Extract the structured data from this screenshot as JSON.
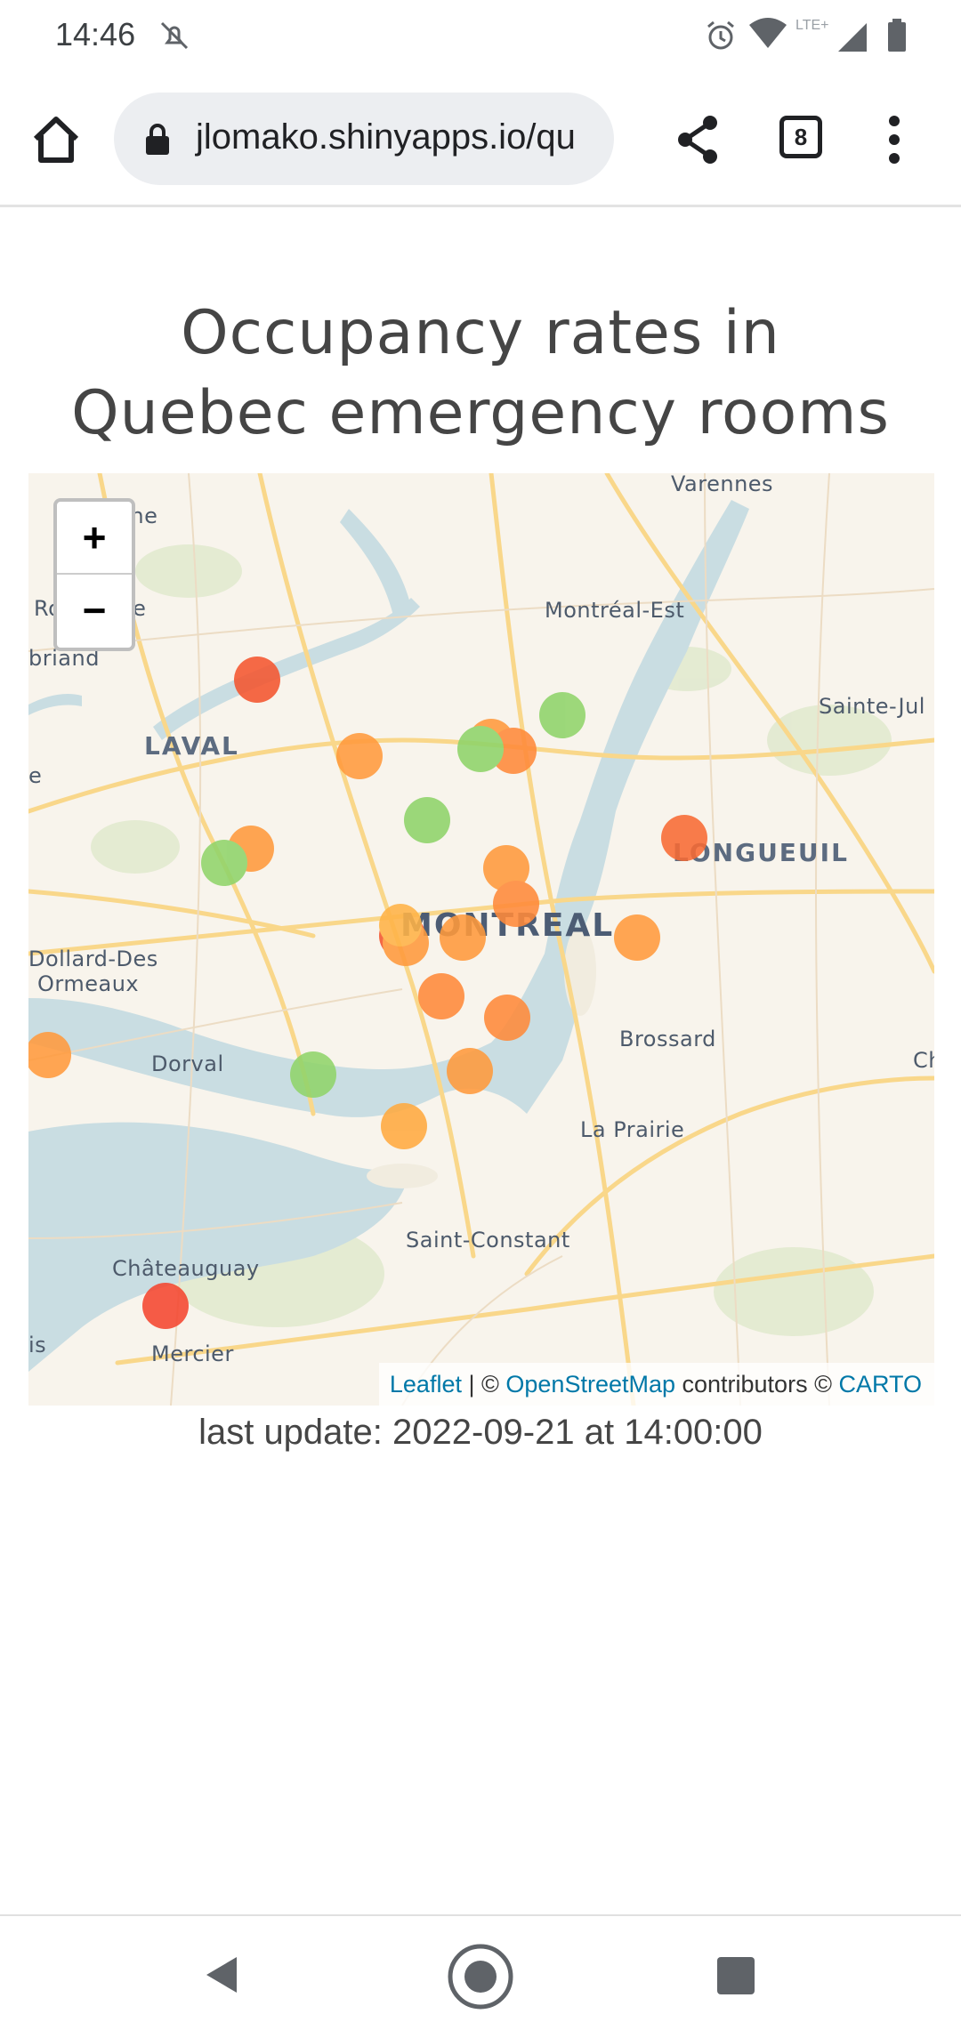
{
  "status_bar": {
    "time": "14:46",
    "network_label": "LTE+",
    "icons": [
      "dnd-off-icon",
      "alarm-icon",
      "wifi-icon",
      "signal-icon",
      "battery-icon"
    ]
  },
  "browser": {
    "url": "jlomako.shinyapps.io/qu",
    "tab_count": "8",
    "icons": [
      "home-icon",
      "lock-icon",
      "share-icon",
      "more-vert-icon"
    ]
  },
  "page": {
    "title_line1": "Occupancy rates in",
    "title_line2": "Quebec emergency rooms",
    "last_update": "last update: 2022-09-21 at 14:00:00"
  },
  "map": {
    "zoom_in": "+",
    "zoom_out": "−",
    "labels": {
      "varennes": "Varennes",
      "aine": "aine",
      "re": "Ro",
      "ere": "ère",
      "briand": "briand",
      "laval": "LAVAL",
      "montreal_est": "Montréal-Est",
      "sainte_jul": "Sainte-Jul",
      "longueuil": "LONGUEUIL",
      "montreal": "MONTREAL",
      "dollard": "Dollard-Des",
      "ormeaux": "Ormeaux",
      "brossard": "Brossard",
      "ch": "Ch",
      "dorval": "Dorval",
      "la_prairie": "La Prairie",
      "saint_constant": "Saint-Constant",
      "chateauguay": "Châteauguay",
      "mercier": "Mercier",
      "is": "is",
      "e": "e"
    },
    "attribution": {
      "leaflet": "Leaflet",
      "sep": " | © ",
      "osm": "OpenStreetMap",
      "contributors": " contributors © ",
      "carto": "CARTO"
    },
    "status_colors": {
      "green": "#8fd46a",
      "orange": "#ff9a3c",
      "red": "#f4552f"
    }
  }
}
